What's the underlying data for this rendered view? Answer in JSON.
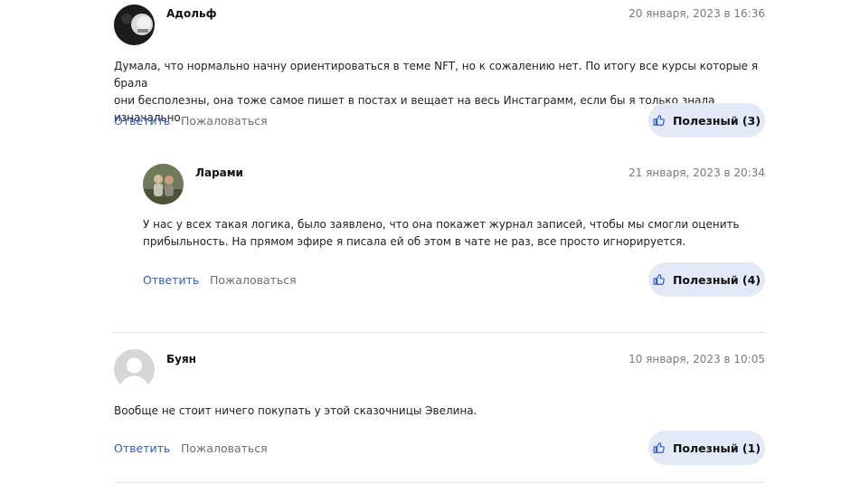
{
  "comments": [
    {
      "author": "Адольф",
      "date": "20 января, 2023 в 16:36",
      "text_line1": "Думала, что нормально начну ориентироваться в теме NFT, но к сожалению нет. По итогу все курсы которые я брала",
      "text_line2": "они бесполезны, она тоже самое пишет в постах и вещает на весь Инстаграмм, если бы я только знала изначально.",
      "reply_label": "Ответить",
      "report_label": "Пожаловаться",
      "useful_label": "Полезный (3)",
      "useful_count": 3
    },
    {
      "author": "Ларами",
      "date": "21 января, 2023 в 20:34",
      "text_line1": "У нас у всех такая логика, было заявлено, что она покажет журнал записей, чтобы мы смогли оценить",
      "text_line2": "прибыльность. На прямом эфире я писала ей об этом в чате не раз, все просто игнорируется.",
      "reply_label": "Ответить",
      "report_label": "Пожаловаться",
      "useful_label": "Полезный (4)",
      "useful_count": 4
    },
    {
      "author": "Буян",
      "date": "10 января, 2023 в 10:05",
      "text_line1": "Вообще не стоит ничего покупать у этой сказочницы Эвелина.",
      "reply_label": "Ответить",
      "report_label": "Пожаловаться",
      "useful_label": "Полезный (1)",
      "useful_count": 1
    }
  ],
  "colors": {
    "link_blue": "#2d5bd3",
    "useful_bg": "#e3e9f7",
    "muted_text": "#7a7a7a",
    "divider": "#e6e6e6"
  },
  "icons": {
    "useful": "thumbs-up-icon",
    "default_avatar": "user-silhouette-icon"
  }
}
